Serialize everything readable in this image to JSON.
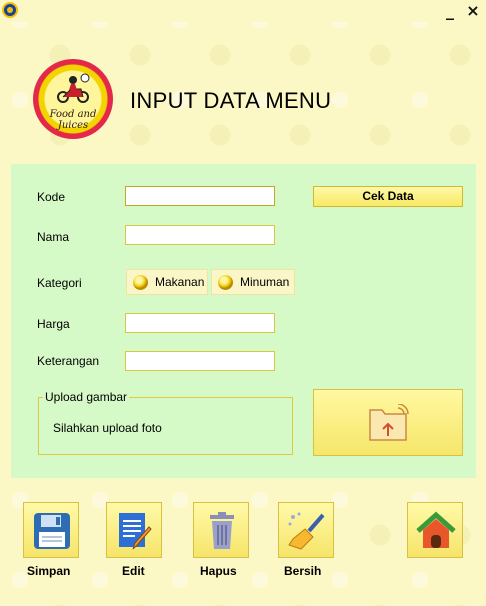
{
  "window": {
    "minimize_glyph": "_",
    "close_glyph": "×"
  },
  "header": {
    "logo_text": "Food and Juices",
    "title": "INPUT DATA MENU"
  },
  "form": {
    "kode_label": "Kode",
    "nama_label": "Nama",
    "kategori_label": "Kategori",
    "harga_label": "Harga",
    "keterangan_label": "Keterangan",
    "kode_value": "",
    "nama_value": "",
    "harga_value": "",
    "keterangan_value": "",
    "cek_button": "Cek Data",
    "kategori_options": [
      "Makanan",
      "Minuman"
    ],
    "upload_title": "Upload gambar",
    "upload_hint": "Silahkan upload foto",
    "upload_icon": "folder-upload-icon"
  },
  "actions": [
    {
      "label": "Simpan",
      "icon": "floppy-disk-icon"
    },
    {
      "label": "Edit",
      "icon": "edit-document-icon"
    },
    {
      "label": "Hapus",
      "icon": "trash-icon"
    },
    {
      "label": "Bersih",
      "icon": "broom-icon"
    },
    {
      "label": "",
      "icon": "home-icon"
    }
  ],
  "colors": {
    "background": "#fbf8c6",
    "panel": "#d6f9c8",
    "button": "#f8ea64",
    "border": "#d8c040",
    "logo_ring": "#e4284a"
  }
}
